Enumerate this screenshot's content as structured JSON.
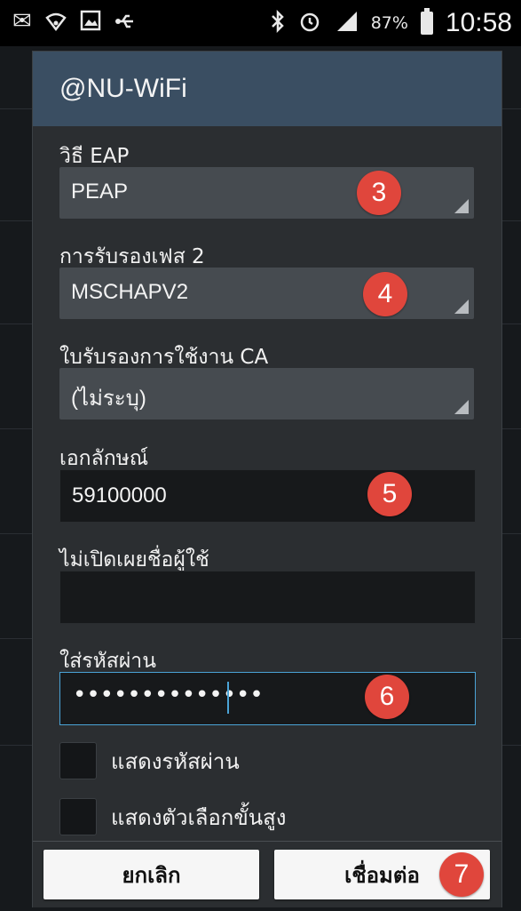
{
  "status_bar": {
    "icons_left": [
      "mail-icon",
      "wifi-icon",
      "image-icon",
      "usb-icon"
    ],
    "icons_right": [
      "bluetooth-icon",
      "alarm-icon",
      "signal-icon"
    ],
    "battery_percent": "87%",
    "time": "10:58"
  },
  "dialog": {
    "title": "@NU-WiFi",
    "eap_method": {
      "label": "วิธี EAP",
      "value": "PEAP",
      "badge": "3"
    },
    "phase2": {
      "label": "การรับรองเฟส 2",
      "value": "MSCHAPV2",
      "badge": "4"
    },
    "ca_cert": {
      "label": "ใบรับรองการใช้งาน CA",
      "value": "(ไม่ระบุ)"
    },
    "identity": {
      "label": "เอกลักษณ์",
      "value": "59100000",
      "badge": "5"
    },
    "anonymous": {
      "label": "ไม่เปิดเผยชื่อผู้ใช้",
      "value": ""
    },
    "password": {
      "label": "ใส่รหัสผ่าน",
      "value": "••••••••••••••",
      "badge": "6"
    },
    "show_password": {
      "label": "แสดงรหัสผ่าน",
      "checked": false
    },
    "show_advanced": {
      "label": "แสดงตัวเลือกขั้นสูง",
      "checked": false
    },
    "cancel_label": "ยกเลิก",
    "connect_label": "เชื่อมต่อ",
    "connect_badge": "7"
  },
  "colors": {
    "title_bar": "#3a4e62",
    "badge": "#e0463c",
    "focus": "#4aa3d6"
  }
}
